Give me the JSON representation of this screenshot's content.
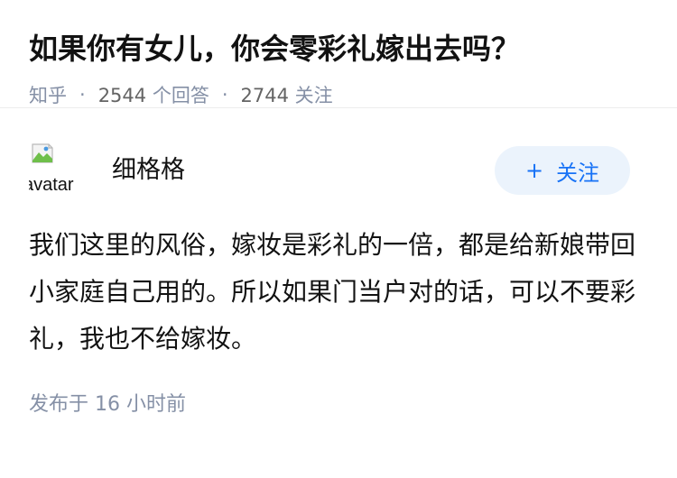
{
  "question": {
    "title": "如果你有女儿，你会零彩礼嫁出去吗？",
    "source": "知乎",
    "answer_count": "2544",
    "answer_label": "个回答",
    "follower_count": "2744",
    "follower_label": "关注",
    "separator": "·"
  },
  "answer": {
    "avatar_alt": "avatar",
    "author_name": "细格格",
    "follow_icon": "plus-icon",
    "follow_symbol": "+",
    "follow_label": "关注",
    "content": "我们这里的风俗，嫁妆是彩礼的一倍，都是给新娘带回小家庭自己用的。所以如果门当户对的话，可以不要彩礼，我也不给嫁妆。",
    "time_prefix": "发布于",
    "time_value": "16 小时前"
  },
  "colors": {
    "title": "#121212",
    "meta": "#8590a6",
    "accent": "#1772f6",
    "follow_bg": "#ebf3fc",
    "divider": "#ededed"
  }
}
